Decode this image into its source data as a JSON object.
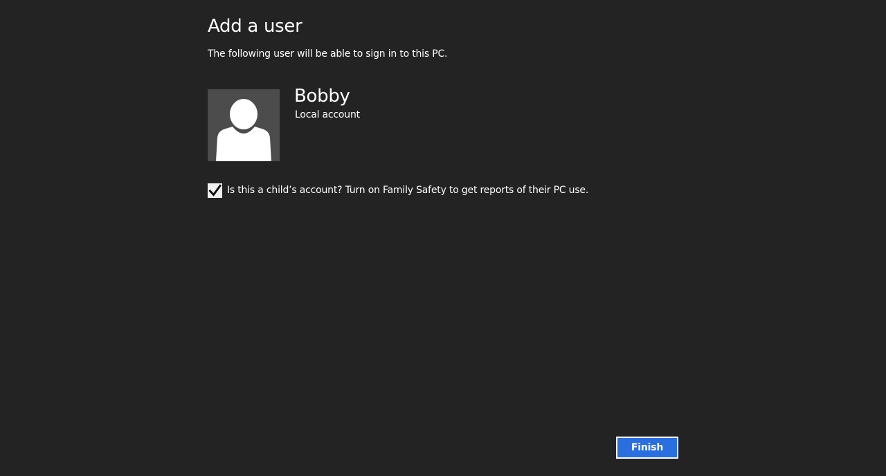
{
  "page": {
    "title": "Add a user",
    "subtitle": "The following user will be able to sign in to this PC."
  },
  "user": {
    "avatar_icon": "user-silhouette-icon",
    "name": "Bobby",
    "account_type": "Local account"
  },
  "family_safety": {
    "checked": true,
    "check_icon": "checkmark-icon",
    "label": "Is this a child’s account? Turn on Family Safety to get reports of their PC use."
  },
  "actions": {
    "finish_label": "Finish"
  },
  "colors": {
    "background": "#232323",
    "avatar_background": "#4c4c4c",
    "accent_button": "#2a6fe0",
    "text": "#ffffff"
  }
}
